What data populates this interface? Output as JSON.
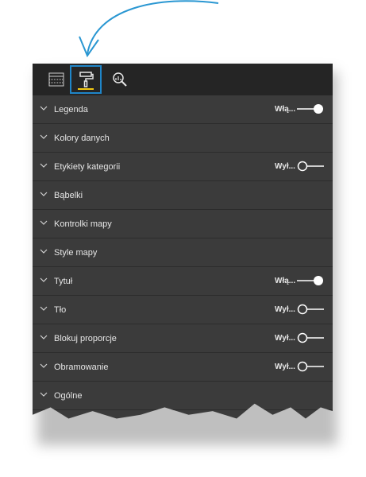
{
  "toolbar": {
    "fields_icon": "fields-grid-icon",
    "format_icon": "paint-roller-icon",
    "analytics_icon": "analytics-magnifier-icon"
  },
  "sections": [
    {
      "label": "Legenda",
      "toggle": "Włą...",
      "on": true
    },
    {
      "label": "Kolory danych"
    },
    {
      "label": "Etykiety kategorii",
      "toggle": "Wył...",
      "on": false
    },
    {
      "label": "Bąbelki"
    },
    {
      "label": "Kontrolki mapy"
    },
    {
      "label": "Style mapy"
    },
    {
      "label": "Tytuł",
      "toggle": "Włą...",
      "on": true
    },
    {
      "label": "Tło",
      "toggle": "Wył...",
      "on": false
    },
    {
      "label": "Blokuj proporcje",
      "toggle": "Wył...",
      "on": false
    },
    {
      "label": "Obramowanie",
      "toggle": "Wył...",
      "on": false
    },
    {
      "label": "Ogólne"
    }
  ],
  "colors": {
    "accent": "#1f86c9",
    "active_underline": "#f2c811",
    "panel_bg": "#3b3b3b",
    "toolbar_bg": "#252525",
    "text": "#e6e6e6"
  }
}
